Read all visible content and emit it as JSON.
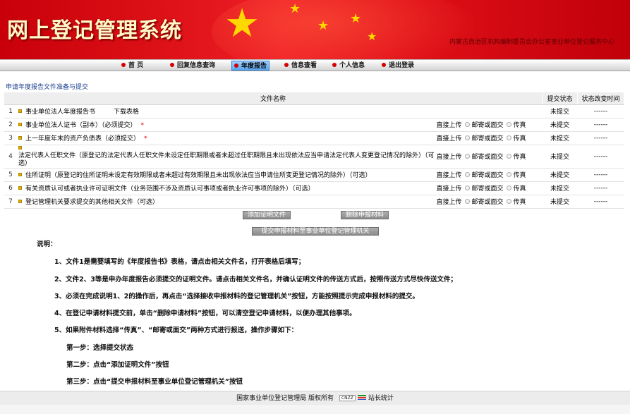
{
  "header": {
    "title": "网上登记管理系统",
    "org": "内蒙古自治区机构编制委员会办公室事业单位登记服务中心"
  },
  "nav": [
    {
      "label": "首 页"
    },
    {
      "label": "回复信息查询"
    },
    {
      "label": "年度报告",
      "active": true
    },
    {
      "label": "信息查看"
    },
    {
      "label": "个人信息"
    },
    {
      "label": "退出登录"
    }
  ],
  "section_title": "申请年度报告文件准备与提交",
  "table": {
    "headers": {
      "name": "文件名称",
      "status": "提交状态",
      "time": "状态改变时间"
    },
    "option_labels": {
      "direct": "直接上传",
      "mail": "邮寄或面交",
      "fax": "传真"
    },
    "rows": [
      {
        "num": "1",
        "name": "事业单位法人年度报告书",
        "download": "下载表格",
        "status": "未提交",
        "time": "------"
      },
      {
        "num": "2",
        "name": "事业单位法人证书（副本）（必须提交）",
        "required": "*",
        "status": "未提交",
        "time": "------"
      },
      {
        "num": "3",
        "name": "上一年度年末的资产负债表（必须提交）",
        "required": "*",
        "status": "未提交",
        "time": "------"
      },
      {
        "num": "4",
        "name": "法定代表人任职文件（原登记的法定代表人任职文件未设定任职期限或者未超过任职期限且未出现依法应当申请法定代表人变更登记情况的除外）（可选）",
        "status": "未提交",
        "time": "------"
      },
      {
        "num": "5",
        "name": "住所证明（原登记的住所证明未设定有效期限或者未超过有效期限且未出现依法应当申请住所变更登记情况的除外）（可选）",
        "status": "未提交",
        "time": "------"
      },
      {
        "num": "6",
        "name": "有关资质认可或者执业许可证明文件（业务范围不涉及资质认可事项或者执业许可事项的除外）（可选）",
        "status": "未提交",
        "time": "------"
      },
      {
        "num": "7",
        "name": "登记管理机关要求提交的其他相关文件（可选）",
        "status": "未提交",
        "time": "------"
      }
    ]
  },
  "buttons": {
    "add": "添加证明文件",
    "delete": "删除申报材料",
    "submit": "提交申报材料至事业单位登记管理机关"
  },
  "notes": {
    "title": "说明：",
    "items": [
      "1、文件1是需要填写的《年度报告书》表格，请点击相关文件名，打开表格后填写；",
      "2、文件2、3等是申办年度报告必须提交的证明文件。请点击相关文件名，并确认证明文件的传送方式后，按照传送方式尽快传送文件；",
      "3、必须在完成说明1、2的操作后，再点击“选择接收申报材料的登记管理机关”按钮，方能按照提示完成申报材料的提交。",
      "4、在登记申请材料提交前，单击“删除申请材料”按钮，可以清空登记申请材料，以便办理其他事项。",
      "5、如果附件材料选择“传真”、“邮寄或面交”两种方式进行报送，操作步骤如下："
    ],
    "steps": [
      "第一步：选择提交状态",
      "第二步：点击“添加证明文件”按钮",
      "第三步：点击“提交申报材料至事业单位登记管理机关”按钮"
    ]
  },
  "footer": {
    "text": "国家事业单位登记管理局 版权所有",
    "cnzz": "CNZZ",
    "stats": "站长统计"
  }
}
